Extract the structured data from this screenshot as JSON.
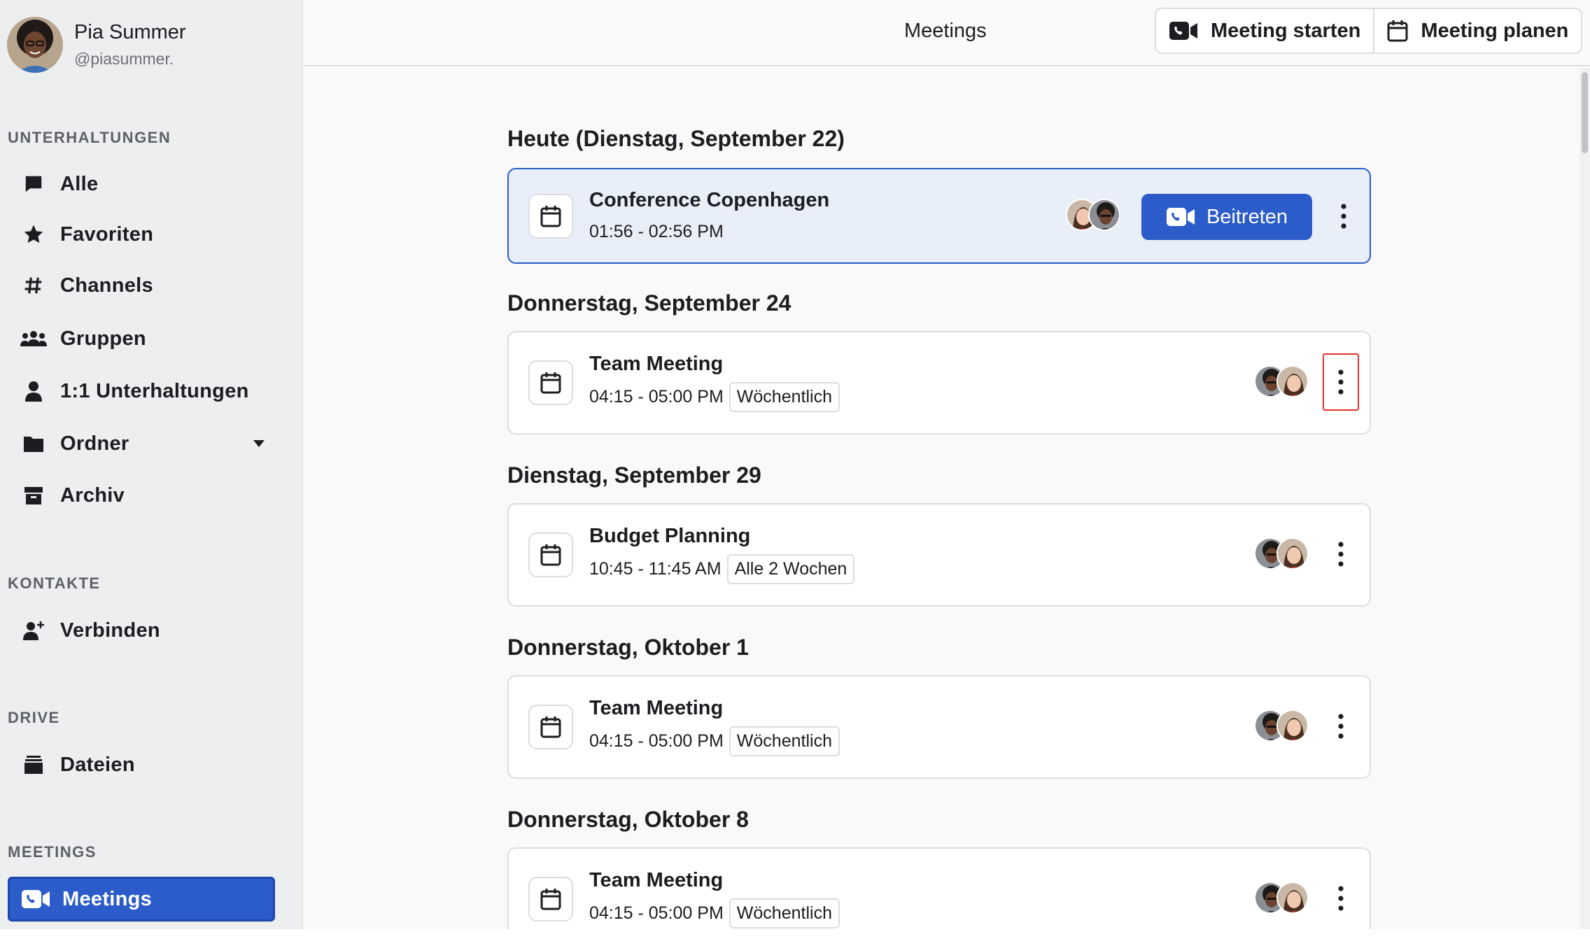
{
  "user": {
    "name": "Pia Summer",
    "handle": "@piasummer."
  },
  "sidebar": {
    "sections": {
      "conversations": "UNTERHALTUNGEN",
      "contacts": "KONTAKTE",
      "drive": "DRIVE",
      "meetings": "MEETINGS"
    },
    "items": [
      {
        "label": "Alle",
        "icon": "chat-bubble-icon"
      },
      {
        "label": "Favoriten",
        "icon": "star-icon"
      },
      {
        "label": "Channels",
        "icon": "hash-icon"
      },
      {
        "label": "Gruppen",
        "icon": "group-icon"
      },
      {
        "label": "1:1 Unterhaltungen",
        "icon": "person-icon"
      },
      {
        "label": "Ordner",
        "icon": "folder-icon"
      },
      {
        "label": "Archiv",
        "icon": "archive-icon"
      },
      {
        "label": "Verbinden",
        "icon": "add-person-icon"
      },
      {
        "label": "Dateien",
        "icon": "files-icon"
      },
      {
        "label": "Meetings",
        "icon": "video-call-icon",
        "active": true
      }
    ]
  },
  "header": {
    "title": "Meetings",
    "start_label": "Meeting starten",
    "plan_label": "Meeting planen"
  },
  "days": [
    {
      "title": "Heute (Dienstag, September 22)"
    },
    {
      "title": "Donnerstag, September 24"
    },
    {
      "title": "Dienstag, September 29"
    },
    {
      "title": "Donnerstag, Oktober 1"
    },
    {
      "title": "Donnerstag, Oktober 8"
    }
  ],
  "meetings": [
    {
      "title": "Conference Copenhagen",
      "time": "01:56 - 02:56 PM",
      "recurrence": "",
      "join_label": "Beitreten"
    },
    {
      "title": "Team Meeting",
      "time": "04:15 - 05:00 PM",
      "recurrence": "Wöchentlich"
    },
    {
      "title": "Budget Planning",
      "time": "10:45 - 11:45 AM",
      "recurrence": "Alle 2 Wochen"
    },
    {
      "title": "Team Meeting",
      "time": "04:15 - 05:00 PM",
      "recurrence": "Wöchentlich"
    },
    {
      "title": "Team Meeting",
      "time": "04:15 - 05:00 PM",
      "recurrence": "Wöchentlich"
    }
  ],
  "colors": {
    "accent": "#2c5cc9",
    "sidebar_bg": "#edeef0",
    "focus_outline": "#e0342d"
  }
}
